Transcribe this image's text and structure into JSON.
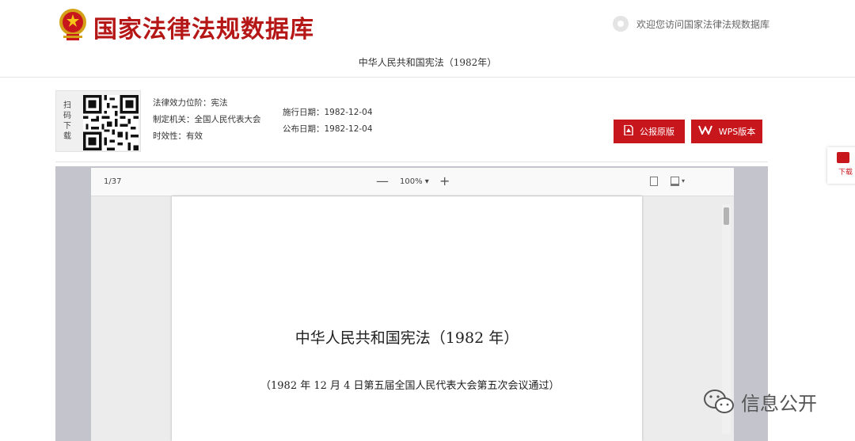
{
  "header": {
    "site_title": "国家法律法规数据库",
    "welcome_text": "欢迎您访问国家法律法规数据库",
    "doc_subtitle": "中华人民共和国宪法（1982年）"
  },
  "info": {
    "scan_label": "扫码下载",
    "effect_level": "法律效力位阶：宪法",
    "authority": "制定机关：全国人民代表大会",
    "validity": "时效性：有效",
    "effective_date": "施行日期：1982-12-04",
    "publish_date": "公布日期：1982-12-04"
  },
  "buttons": {
    "pdf_label": "公报原版",
    "wps_label": "WPS版本"
  },
  "viewer": {
    "page_count": "1/37",
    "zoom_minus": "—",
    "zoom_level": "100%",
    "zoom_plus": "+",
    "zoom_caret": "▾",
    "save_caret": "▾"
  },
  "page": {
    "title": "中华人民共和国宪法（1982 年）",
    "note": "（1982 年 12 月 4 日第五届全国人民代表大会第五次会议通过）"
  },
  "side": {
    "download_label": "下载"
  },
  "watermark": {
    "text": "信息公开"
  },
  "colors": {
    "brand_red": "#c8161d",
    "title_red": "#b51616",
    "viewer_bg": "#c4c4cc"
  },
  "icons": [
    "national-emblem-icon",
    "globe-icon",
    "qr-code",
    "pdf-icon",
    "wps-icon",
    "document-icon",
    "save-icon",
    "download-icon",
    "wechat-icon"
  ]
}
